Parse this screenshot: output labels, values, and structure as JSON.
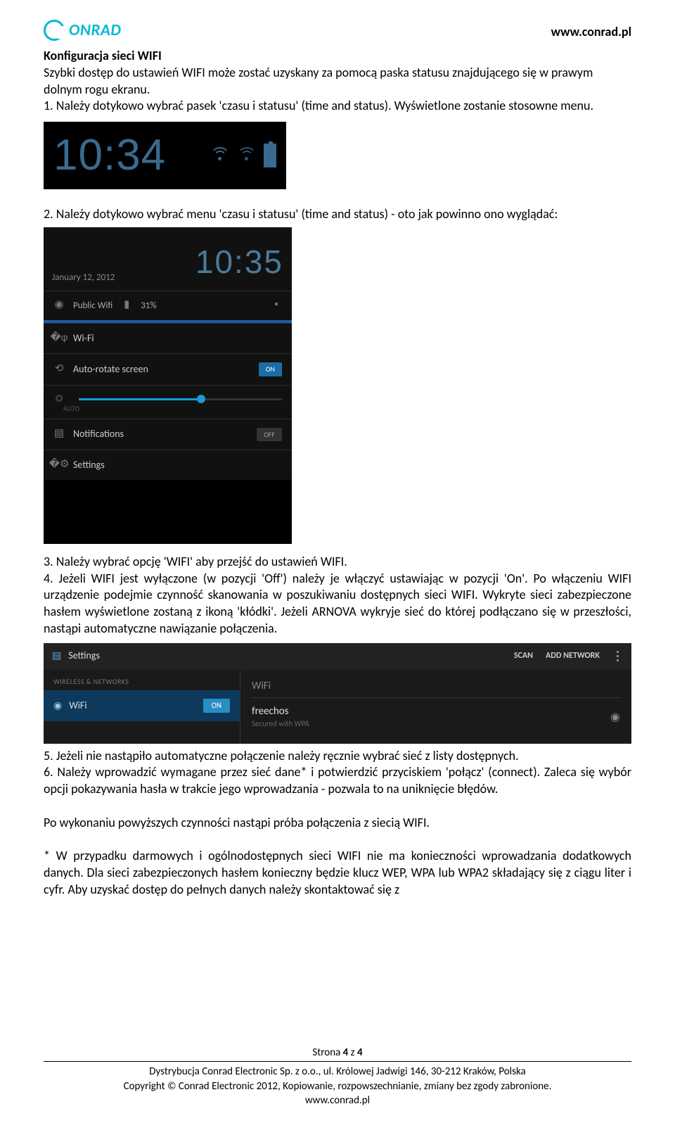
{
  "header": {
    "logo_text": "ONRAD",
    "url": "www.conrad.pl"
  },
  "section_title": "Konfiguracja sieci WIFI",
  "intro": "Szybki dostęp do ustawień WIFI może zostać uzyskany za pomocą paska statusu znajdującego się w prawym dolnym rogu ekranu.",
  "step1": "1. Należy dotykowo wybrać pasek 'czasu i statusu' (time and status). Wyświetlone zostanie stosowne menu.",
  "ss1": {
    "time": "10:34"
  },
  "step2": "2. Należy dotykowo wybrać menu 'czasu i statusu' (time and status) - oto jak powinno ono wyglądać:",
  "ss2": {
    "date": "January 12, 2012",
    "time": "10:35",
    "public_wifi": "Public Wifi",
    "signal": "31%",
    "wifi_label": "Wi-Fi",
    "auto_rotate": "Auto-rotate screen",
    "on": "ON",
    "auto": "AUTO",
    "notifications": "Notifications",
    "off": "OFF",
    "settings": "Settings"
  },
  "step3": "3. Należy wybrać opcję 'WIFI' aby przejść do ustawień WIFI.",
  "step4": "4. Jeżeli WIFI jest wyłączone (w pozycji 'Off') należy je włączyć ustawiając w pozycji 'On'. Po włączeniu WIFI urządzenie podejmie czynność skanowania w poszukiwaniu dostępnych sieci WIFI. Wykryte sieci zabezpieczone hasłem wyświetlone zostaną z ikoną 'kłódki'. Jeżeli ARNOVA wykryje sieć do której podłączano się w przeszłości, nastąpi automatyczne nawiązanie połączenia.",
  "ss3": {
    "settings": "Settings",
    "scan": "SCAN",
    "add_network": "ADD NETWORK",
    "category": "WIRELESS & NETWORKS",
    "wifi": "WiFi",
    "on": "ON",
    "right_header": "WiFi",
    "network_name": "freechos",
    "network_sub": "Secured with WPA"
  },
  "step5": "5. Jeżeli nie nastąpiło automatyczne połączenie należy ręcznie wybrać sieć z listy dostępnych.",
  "step6": "6. Należy wprowadzić wymagane przez sieć dane* i potwierdzić przyciskiem 'połącz' (connect). Zaleca się wybór opcji pokazywania hasła w trakcie jego wprowadzania - pozwala to na uniknięcie błędów.",
  "after_steps": "Po wykonaniu powyższych czynności nastąpi próba połączenia z siecią WIFI.",
  "footnote": "* W przypadku darmowych i ogólnodostępnych sieci WIFI nie ma konieczności wprowadzania dodatkowych danych. Dla sieci zabezpieczonych hasłem konieczny będzie klucz WEP, WPA lub WPA2 składający się z ciągu liter i cyfr. Aby uzyskać dostęp do pełnych danych należy skontaktować się z",
  "footer": {
    "page_label_a": "Strona ",
    "page_current": "4",
    "page_label_b": " z ",
    "page_total": "4",
    "line1": "Dystrybucja Conrad Electronic Sp. z o.o., ul. Królowej Jadwigi 146, 30-212 Kraków, Polska",
    "line2": "Copyright © Conrad Electronic 2012, Kopiowanie, rozpowszechnianie, zmiany bez zgody zabronione.",
    "line3": "www.conrad.pl"
  }
}
